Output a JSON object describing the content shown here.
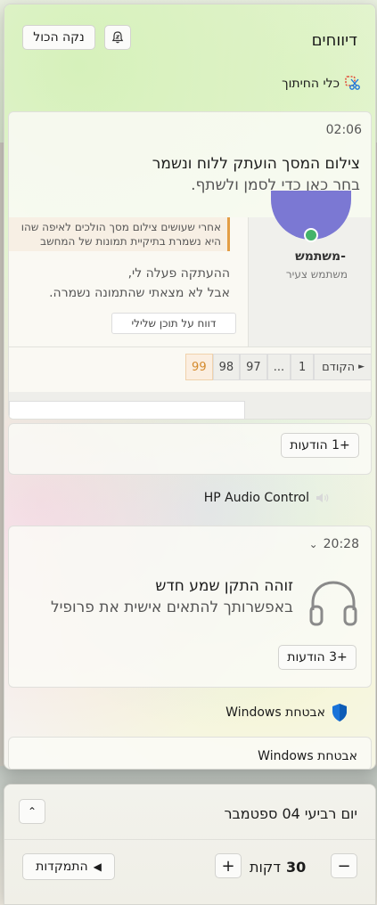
{
  "header": {
    "title": "דיווחים",
    "clear_all": "נקה הכול"
  },
  "snipping": {
    "app_name": "כלי החיתוך",
    "time": "02:06",
    "title": "צילום המסך הועתק ללוח ונשמר",
    "subtitle": "בחר כאן כדי לסמן ולשתף.",
    "preview": {
      "quote_line1": "אחרי שעושים צילום מסך הולכים לאיפה שהו",
      "quote_line2": "היא נשמרת בתיקיית תמונות של המחשב",
      "username": "-משתמש",
      "user_role": "משתמש צעיר",
      "post_line1": "ההעתקה פעלה לי,",
      "post_line2": "אבל לא מצאתי שהתמונה נשמרה.",
      "report_button": "דווח על תוכן שלילי",
      "pager": [
        "הקודם",
        "1",
        "...",
        "97",
        "98",
        "99"
      ],
      "pager_active": "99"
    },
    "more_button": "+1 הודעות"
  },
  "hp_audio": {
    "app_name": "HP Audio Control",
    "time": "20:28",
    "title": "זוהה התקן שמע חדש",
    "subtitle": "באפשרותך להתאים אישית את פרופיל",
    "more_button": "+3 הודעות"
  },
  "security": {
    "app_name": "אבטחת Windows",
    "card_title": "אבטחת Windows"
  },
  "calendar": {
    "date": "יום רביעי 04 ספטמבר",
    "minutes_value": "30",
    "minutes_unit": "דקות",
    "focus_button": "התמקדות"
  },
  "colors": {
    "accent_active": "#d48a2c",
    "security_shield": "#1a73d9"
  }
}
